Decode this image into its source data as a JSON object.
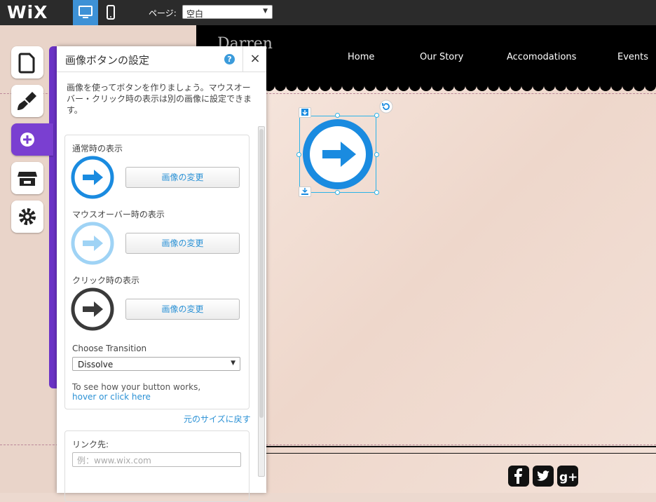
{
  "topbar": {
    "logo": "WiX",
    "page_label": "ページ:",
    "page_select_value": "空白",
    "desktop_icon": "desktop-icon",
    "mobile_icon": "mobile-icon"
  },
  "site": {
    "title": "Darren",
    "nav": [
      "Home",
      "Our Story",
      "Accomodations",
      "Events"
    ],
    "social": [
      "facebook-icon",
      "twitter-icon",
      "google-plus-icon"
    ]
  },
  "left_tools": [
    "pages-icon",
    "design-icon",
    "add-icon",
    "store-icon",
    "settings-icon"
  ],
  "panel": {
    "title": "画像ボタンの設定",
    "help": "?",
    "close": "×",
    "description": "画像を使ってボタンを作りましょう。マウスオーバー・クリック時の表示は別の画像に設定できます。",
    "states": [
      {
        "label": "通常時の表示",
        "button": "画像の変更",
        "color": "#1a8be0"
      },
      {
        "label": "マウスオーバー時の表示",
        "button": "画像の変更",
        "color": "#9fd3f5"
      },
      {
        "label": "クリック時の表示",
        "button": "画像の変更",
        "color": "#3a3a3a"
      }
    ],
    "transition_label": "Choose Transition",
    "transition_value": "Dissolve",
    "hint_text": "To see how your button works,",
    "hint_link": "hover or click here",
    "restore_link": "元のサイズに戻す",
    "link_label": "リンク先:",
    "link_placeholder": "例：www.wix.com"
  },
  "colors": {
    "accent": "#3d91d6",
    "purple": "#7a3fd1",
    "button_blue": "#1a8be0"
  }
}
